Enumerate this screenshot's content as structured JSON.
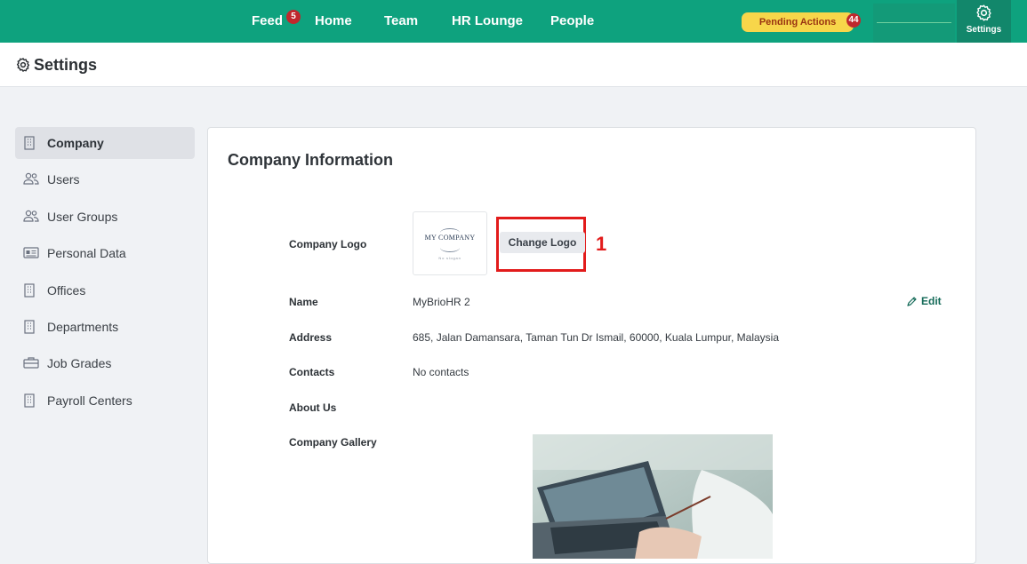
{
  "nav": {
    "items": [
      {
        "label": "Feed",
        "badge": "5"
      },
      {
        "label": "Home"
      },
      {
        "label": "Team"
      },
      {
        "label": "HR Lounge"
      },
      {
        "label": "People"
      }
    ],
    "pending_actions": {
      "label": "Pending Actions",
      "count": "44"
    },
    "settings_label": "Settings",
    "colors": {
      "bar": "#0ea27e",
      "badge": "#c0282d",
      "pending": "#f7d64a"
    }
  },
  "header": {
    "title": "Settings",
    "icon": "gear-icon"
  },
  "sidebar": {
    "items": [
      {
        "label": "Company",
        "icon": "building-icon",
        "active": true
      },
      {
        "label": "Users",
        "icon": "users-icon"
      },
      {
        "label": "User Groups",
        "icon": "users-icon"
      },
      {
        "label": "Personal Data",
        "icon": "id-card-icon"
      },
      {
        "label": "Offices",
        "icon": "building-icon"
      },
      {
        "label": "Departments",
        "icon": "building-icon"
      },
      {
        "label": "Job Grades",
        "icon": "briefcase-icon"
      },
      {
        "label": "Payroll Centers",
        "icon": "building-icon"
      }
    ]
  },
  "company": {
    "section_title": "Company Information",
    "logo_label": "Company Logo",
    "logo_text": "MY COMPANY",
    "logo_tagline": "No slogan",
    "change_logo": "Change Logo",
    "step_marker": "1",
    "name_label": "Name",
    "name_value": "MyBrioHR 2",
    "edit_label": "Edit",
    "address_label": "Address",
    "address_value": "685, Jalan Damansara, Taman Tun Dr Ismail, 60000, Kuala Lumpur, Malaysia",
    "contacts_label": "Contacts",
    "contacts_value": "No contacts",
    "about_label": "About Us",
    "about_value": "",
    "gallery_label": "Company Gallery"
  }
}
